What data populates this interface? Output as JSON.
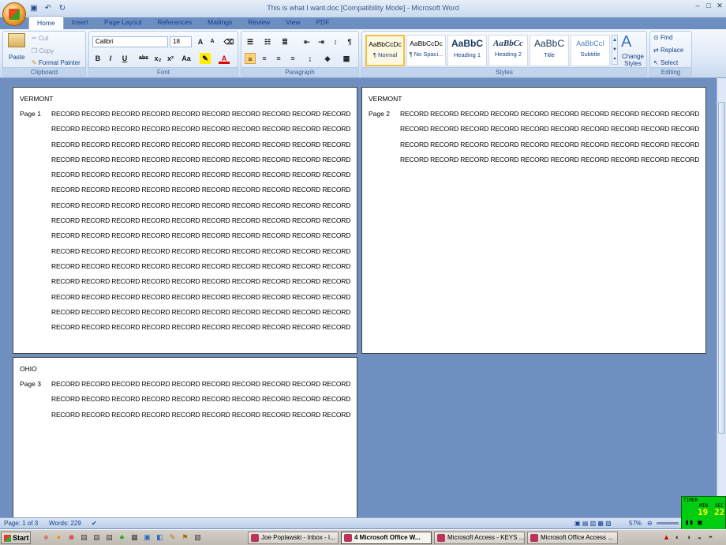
{
  "window": {
    "title": "This is what I want.doc [Compatibility Mode] - Microsoft Word",
    "controls": [
      "–",
      "□",
      "✕"
    ]
  },
  "qat": [
    "save-icon",
    "undo-icon",
    "redo-icon"
  ],
  "tabs": [
    "Home",
    "Insert",
    "Page Layout",
    "References",
    "Mailings",
    "Review",
    "View",
    "PDF"
  ],
  "ribbon": {
    "clipboard": {
      "label": "Clipboard",
      "paste": "Paste",
      "cut": "Cut",
      "copy": "Copy",
      "format_painter": "Format Painter"
    },
    "font": {
      "label": "Font",
      "name": "Calibri",
      "size": "18",
      "buttons": [
        "B",
        "I",
        "U",
        "abc",
        "x₂",
        "x²",
        "Aa"
      ]
    },
    "paragraph": {
      "label": "Paragraph"
    },
    "styles": {
      "label": "Styles",
      "tiles": [
        {
          "sample": "AaBbCcDc",
          "name": "¶ Normal"
        },
        {
          "sample": "AaBbCcDc",
          "name": "¶ No Spaci..."
        },
        {
          "sample": "AaBbC",
          "name": "Heading 1"
        },
        {
          "sample": "AaBbCc",
          "name": "Heading 2"
        },
        {
          "sample": "AaBbC",
          "name": "Title"
        },
        {
          "sample": "AaBbCcI",
          "name": "Subtitle"
        }
      ],
      "change_styles": "Change Styles"
    },
    "editing": {
      "label": "Editing",
      "find": "Find",
      "replace": "Replace",
      "select": "Select"
    }
  },
  "pages": [
    {
      "state": "VERMONT",
      "label": "Page 1",
      "rows": 15
    },
    {
      "state": "VERMONT",
      "label": "Page 2",
      "rows": 4
    },
    {
      "state": "OHIO",
      "label": "Page 3",
      "rows": 3
    }
  ],
  "record_line": "RECORD RECORD RECORD RECORD RECORD RECORD RECORD RECORD RECORD RECORD",
  "status": {
    "page": "Page: 1 of 3",
    "words": "Words: 229",
    "zoom": "57%"
  },
  "timer": {
    "label": "TIMER",
    "min_label": "MIN",
    "sec_label": "SEC",
    "min": "19",
    "sec": "22"
  },
  "taskbar": {
    "start": "Start",
    "tasks": [
      "Joe Poplawski - Inbox - I...",
      "4 Microsoft Office W...",
      "Microsoft Access - KEYS ...",
      "Microsoft Office Access ..."
    ]
  }
}
